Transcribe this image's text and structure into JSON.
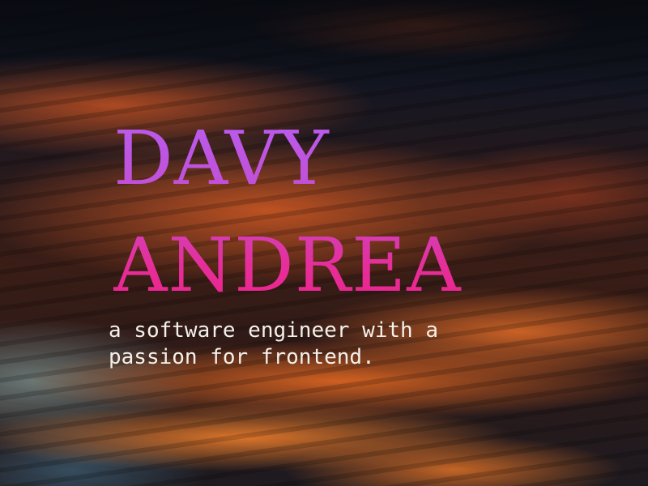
{
  "hero": {
    "name_line1": "DAVY",
    "name_line2": "ANDREA",
    "tagline_line1": "a software engineer with a",
    "tagline_line2": "passion for frontend."
  },
  "colors": {
    "name_gradient_top": "#b85ef3",
    "name_gradient_bottom": "#ef1f86",
    "tagline": "#f5f0ea",
    "sky_dark": "#0d1018",
    "cloud_orange": "#e26822"
  }
}
